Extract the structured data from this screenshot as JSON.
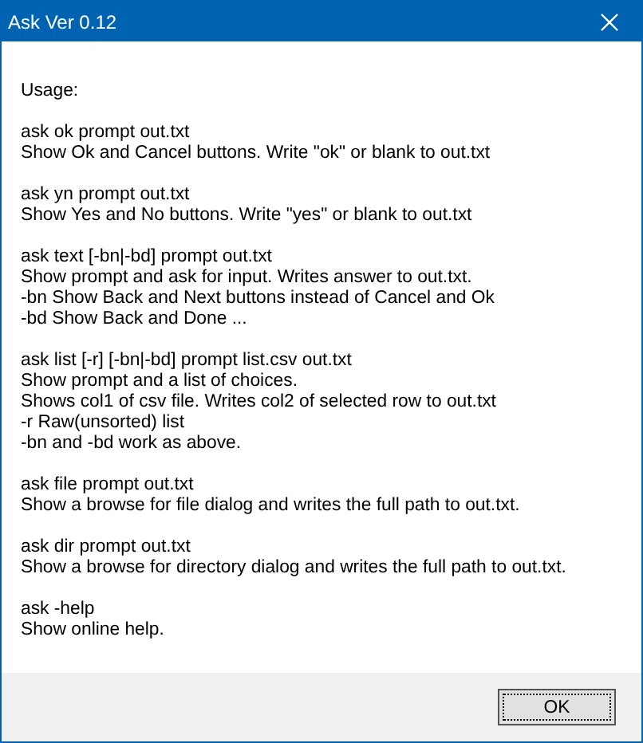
{
  "window": {
    "title": "Ask Ver 0.12"
  },
  "sections": [
    {
      "lines": [
        "Usage:"
      ]
    },
    {
      "lines": [
        "ask ok prompt out.txt",
        "Show Ok and Cancel buttons. Write \"ok\" or blank to out.txt"
      ]
    },
    {
      "lines": [
        "ask yn prompt out.txt",
        "Show Yes and No buttons. Write \"yes\" or blank to out.txt"
      ]
    },
    {
      "lines": [
        "ask text [-bn|-bd] prompt out.txt",
        "Show prompt and ask for input. Writes answer to out.txt.",
        "-bn Show Back and Next buttons instead of Cancel and Ok",
        "-bd Show Back and Done ..."
      ]
    },
    {
      "lines": [
        "ask list [-r] [-bn|-bd] prompt list.csv out.txt",
        "Show prompt and a list of choices.",
        "Shows col1 of csv file. Writes col2 of selected row to out.txt",
        "-r Raw(unsorted) list",
        "-bn and -bd work as above."
      ]
    },
    {
      "lines": [
        "ask file prompt out.txt",
        "Show a browse for file dialog and writes the full path to out.txt."
      ]
    },
    {
      "lines": [
        "ask dir prompt out.txt",
        "Show a browse for directory dialog and writes the full path to out.txt."
      ]
    },
    {
      "lines": [
        "ask -help",
        "Show online help."
      ]
    }
  ],
  "buttons": [
    {
      "label": "OK",
      "focused": true
    }
  ]
}
